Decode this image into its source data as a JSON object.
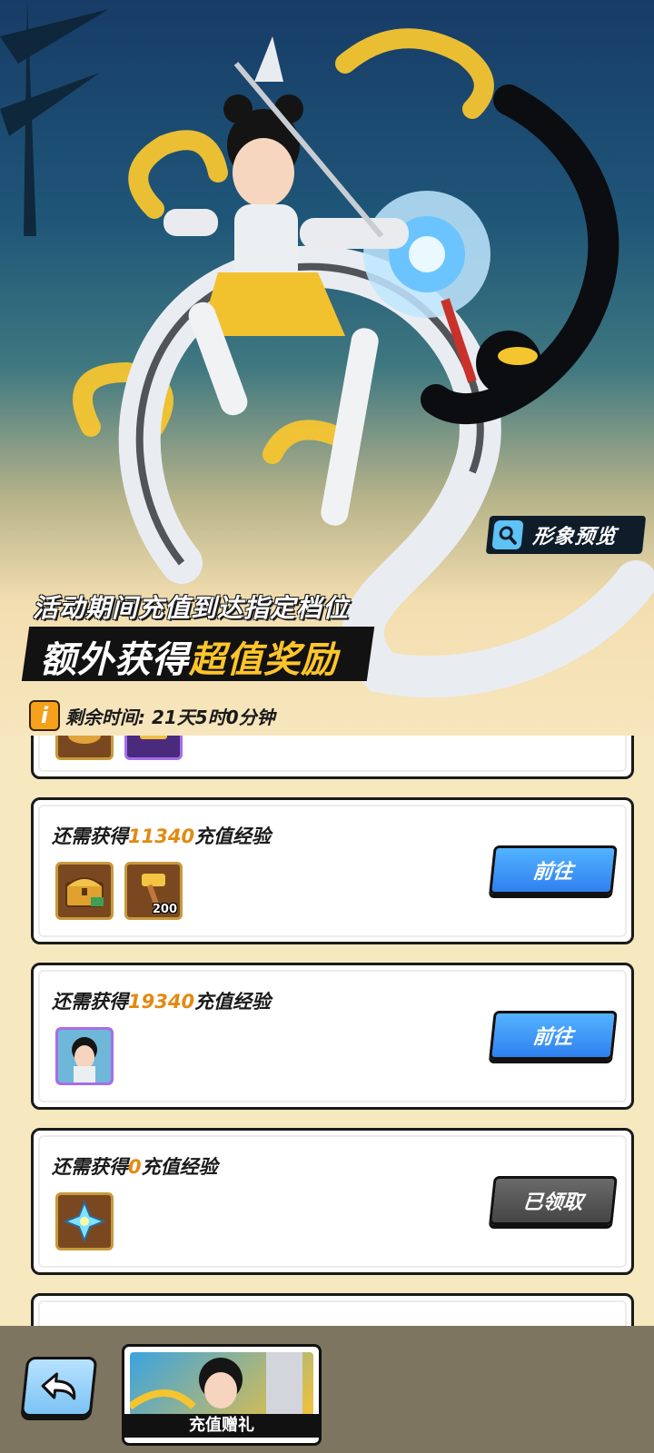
{
  "hero": {
    "preview_label": "形象预览",
    "headline_line1": "活动期间充值到达指定档位",
    "headline_line2_plain": "额外获得",
    "headline_line2_highlight": "超值奖励",
    "timer_icon": "i",
    "remaining_time": "剩余时间: 21天5时0分钟"
  },
  "rewards": [
    {
      "requirement_prefix": "还需获得",
      "amount": "11340",
      "requirement_suffix": "充值经验",
      "items": [
        {
          "icon": "treasure-chest-icon",
          "count": ""
        },
        {
          "icon": "golden-hammer-icon",
          "count": "200"
        }
      ],
      "button_label": "前往",
      "button_state": "go"
    },
    {
      "requirement_prefix": "还需获得",
      "amount": "19340",
      "requirement_suffix": "充值经验",
      "items": [
        {
          "icon": "character-avatar-icon",
          "count": ""
        }
      ],
      "button_label": "前往",
      "button_state": "go"
    },
    {
      "requirement_prefix": "还需获得",
      "amount": "0",
      "requirement_suffix": "充值经验",
      "items": [
        {
          "icon": "crystal-star-icon",
          "count": ""
        }
      ],
      "button_label": "已领取",
      "button_state": "claimed"
    }
  ],
  "bottom": {
    "back_icon": "back-arrow-icon",
    "tab_label": "充值赠礼"
  },
  "colors": {
    "accent_gold": "#ffc52a",
    "amount_orange": "#e28a12",
    "button_blue": "#2f80f0",
    "button_gray": "#454545",
    "page_bg": "#f6e8bf"
  }
}
